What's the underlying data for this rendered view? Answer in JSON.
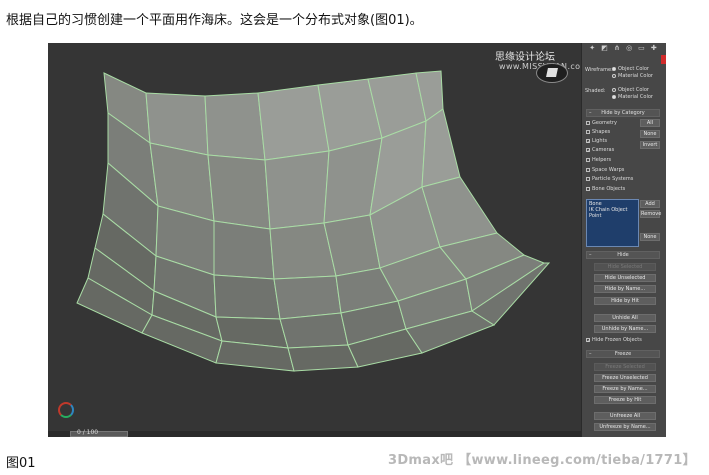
{
  "caption_top": "根据自己的习惯创建一个平面用作海床。这会是一个分布式对象(图01)。",
  "caption_bottom": "图01",
  "credit": "3Dmax吧 【www.lineeg.com/tieba/1771】",
  "watermark": {
    "line1": "思缘设计论坛",
    "line2": "www.MISSVUAN.com"
  },
  "timeline": {
    "label": "0 / 100"
  },
  "colors": {
    "mesh_face": "#8a8d89",
    "mesh_wire": "#a9dca5",
    "viewport_bg": "#353535",
    "listbox": "#1f3e6b"
  },
  "panel": {
    "tabs": [
      "create-icon",
      "modify-icon",
      "hierarchy-icon",
      "motion-icon",
      "display-icon",
      "utilities-icon"
    ],
    "wireframe": {
      "label": "Wireframe:",
      "options": [
        "Object Color",
        "Material Color"
      ],
      "selected": 0
    },
    "shaded": {
      "label": "Shaded:",
      "options": [
        "Object Color",
        "Material Color"
      ],
      "selected": 1
    },
    "hide_by_category": {
      "title": "Hide by Category",
      "items": [
        {
          "label": "Geometry",
          "checked": false
        },
        {
          "label": "Shapes",
          "checked": false
        },
        {
          "label": "Lights",
          "checked": true
        },
        {
          "label": "Cameras",
          "checked": true
        },
        {
          "label": "Helpers",
          "checked": false
        },
        {
          "label": "Space Warps",
          "checked": false
        },
        {
          "label": "Particle Systems",
          "checked": false
        },
        {
          "label": "Bone Objects",
          "checked": false
        }
      ],
      "buttons": {
        "all": "All",
        "none": "None",
        "invert": "Invert"
      },
      "list_items": [
        "Bone",
        "IK Chain Object",
        "Point"
      ],
      "list_buttons": {
        "add": "Add",
        "remove": "Remove",
        "none": "None"
      }
    },
    "hide": {
      "title": "Hide",
      "buttons": [
        "Hide Selected",
        "Hide Unselected",
        "Hide by Name...",
        "Hide by Hit",
        "Unhide All",
        "Unhide by Name..."
      ],
      "hide_frozen": {
        "label": "Hide Frozen Objects",
        "checked": true
      }
    },
    "freeze": {
      "title": "Freeze",
      "buttons": [
        "Freeze Selected",
        "Freeze Unselected",
        "Freeze by Name...",
        "Freeze by Hit",
        "Unfreeze All",
        "Unfreeze by Name..."
      ]
    }
  }
}
